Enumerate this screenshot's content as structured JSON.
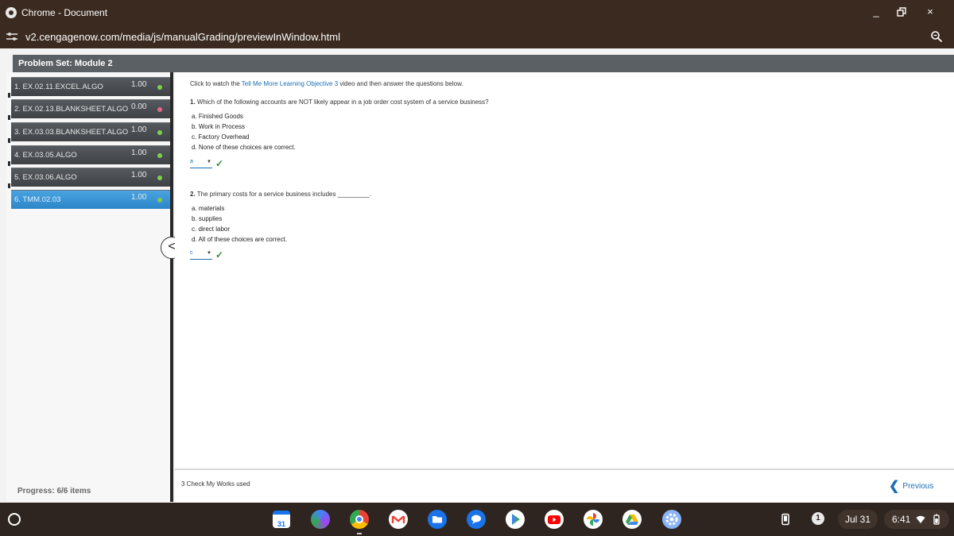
{
  "window": {
    "title": "Chrome - Document",
    "url": "v2.cengagenow.com/media/js/manualGrading/previewInWindow.html",
    "minimize": "_",
    "close": "×"
  },
  "header": {
    "title": "Problem Set: Module 2"
  },
  "sidebar": {
    "items": [
      {
        "label": "1. EX.02.11.EXCEL.ALGO",
        "score": "1.00",
        "status": "correct"
      },
      {
        "label": "2. EX.02.13.BLANKSHEET.ALGO",
        "score": "0.00",
        "status": "incorrect"
      },
      {
        "label": "3. EX.03.03.BLANKSHEET.ALGO",
        "score": "1.00",
        "status": "correct"
      },
      {
        "label": "4. EX.03.05.ALGO",
        "score": "1.00",
        "status": "correct"
      },
      {
        "label": "5. EX.03.06.ALGO",
        "score": "1.00",
        "status": "correct"
      },
      {
        "label": "6. TMM.02.03",
        "score": "1.00",
        "status": "correct",
        "active": true
      }
    ],
    "progress": "Progress: 6/6 items",
    "collapse_glyph": "<"
  },
  "content": {
    "intro_prefix": "Click to watch the",
    "intro_link": "Tell Me More Learning Objective 3",
    "intro_suffix": "video and then answer the questions below.",
    "q1": {
      "number": "1.",
      "text": "Which of the following accounts are NOT likely appear in a job order cost system of a service business?",
      "options": [
        "a. Finished Goods",
        "b. Work in Process",
        "c. Factory Overhead",
        "d. None of these choices are correct."
      ],
      "answer": "a"
    },
    "q2": {
      "number": "2.",
      "text": "The primary costs for a service business includes _________.",
      "options": [
        "a. materials",
        "b. supplies",
        "c. direct labor",
        "d. All of these choices are correct."
      ],
      "answer": "c"
    },
    "check_glyph": "✓"
  },
  "footer": {
    "check_my_works": "3 Check My Works used",
    "previous": "Previous",
    "previous_glyph": "❮"
  },
  "shelf": {
    "calendar_day": "31",
    "notification_count": "1",
    "date": "Jul 31",
    "time": "6:41"
  },
  "colors": {
    "accent": "#2c86c9",
    "link": "#1c6fb3",
    "correct": "#2f8f2f",
    "titlebar": "#3a2a1f"
  }
}
